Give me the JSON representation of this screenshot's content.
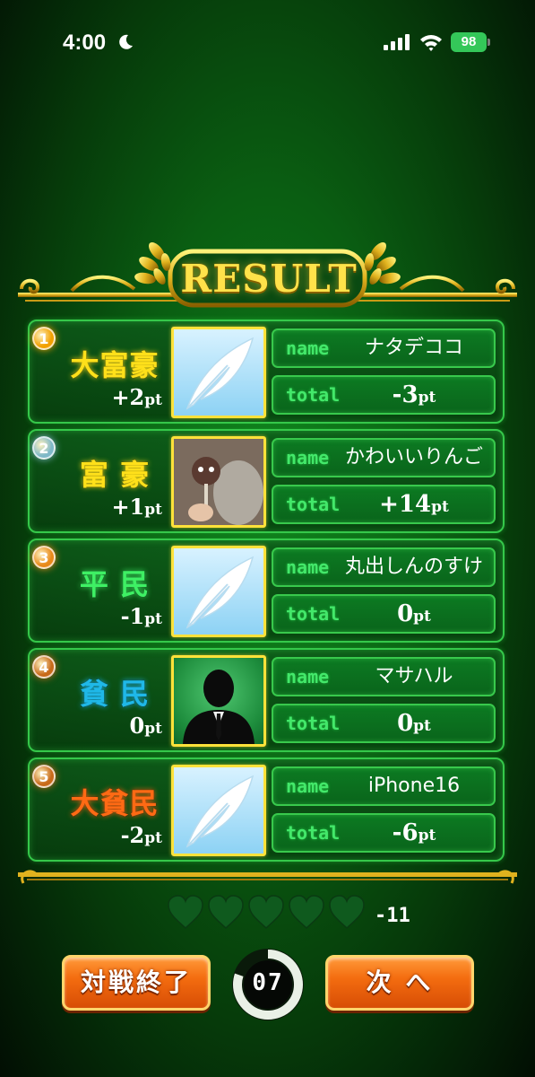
{
  "status_bar": {
    "time": "4:00",
    "battery": "98"
  },
  "header": {
    "title": "RESULT"
  },
  "rows": [
    {
      "rank": "1",
      "title": "大富豪",
      "title_color": "#ffe01a",
      "badge_color": "#f2a000",
      "points_sign": "+2",
      "points_unit": "pt",
      "avatar": "feather-icon",
      "name_label": "name",
      "name": "ナタデココ",
      "total_label": "total",
      "total": "-3",
      "total_unit": "pt"
    },
    {
      "rank": "2",
      "title": "富 豪",
      "title_color": "#ffe01a",
      "badge_color": "#7fb8c8",
      "points_sign": "+1",
      "points_unit": "pt",
      "avatar": "user-photo",
      "name_label": "name",
      "name": "かわいいりんご",
      "total_label": "total",
      "total": "+14",
      "total_unit": "pt"
    },
    {
      "rank": "3",
      "title": "平 民",
      "title_color": "#3ef064",
      "badge_color": "#e8891a",
      "points_sign": "-1",
      "points_unit": "pt",
      "avatar": "feather-icon",
      "name_label": "name",
      "name": "丸出しんのすけ",
      "total_label": "total",
      "total": "0",
      "total_unit": "pt"
    },
    {
      "rank": "4",
      "title": "貧 民",
      "title_color": "#1fb8e8",
      "badge_color": "#c86a1a",
      "points_sign": "0",
      "points_unit": "pt",
      "avatar": "silhouette-icon",
      "name_label": "name",
      "name": "マサハル",
      "total_label": "total",
      "total": "0",
      "total_unit": "pt"
    },
    {
      "rank": "5",
      "title": "大貧民",
      "title_color": "#ff6a14",
      "badge_color": "#c86a1a",
      "points_sign": "-2",
      "points_unit": "pt",
      "avatar": "feather-icon",
      "name_label": "name",
      "name": "iPhone16",
      "total_label": "total",
      "total": "-6",
      "total_unit": "pt"
    }
  ],
  "hearts": {
    "count": 5,
    "score": "-11",
    "color": "#0f5a1e"
  },
  "buttons": {
    "end_match": "対戦終了",
    "next": "次 へ"
  },
  "timer": {
    "value": "07",
    "fraction": 0.8
  },
  "colors": {
    "accent_gold": "#ffe24a",
    "frame_green": "#35c84a",
    "button_orange": "#f46d10"
  }
}
